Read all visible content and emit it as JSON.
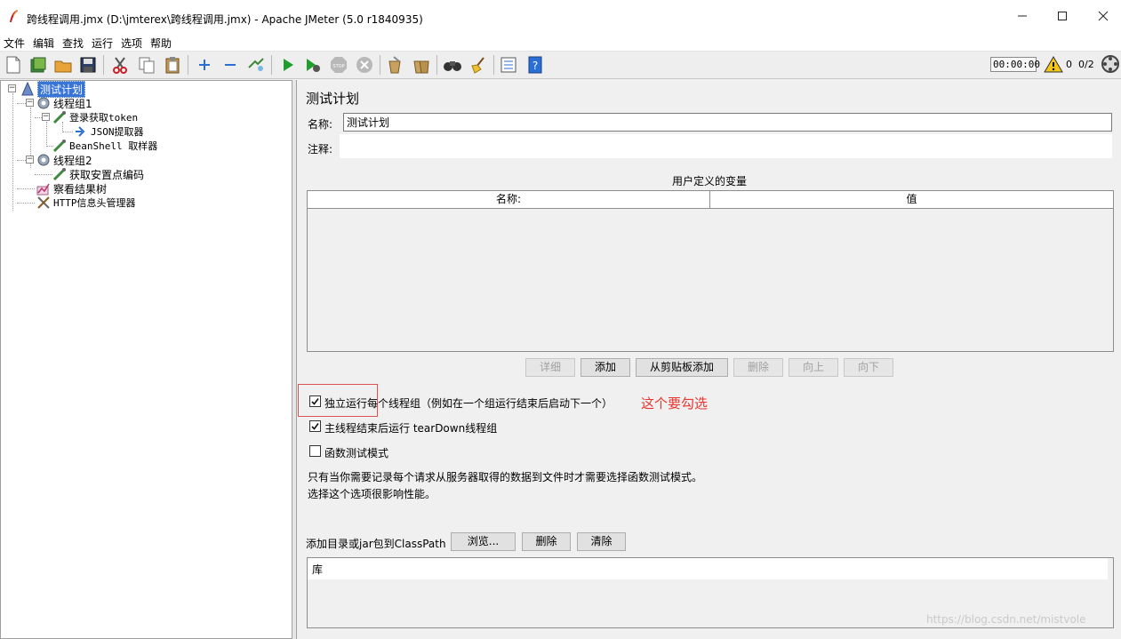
{
  "window": {
    "title": "跨线程调用.jmx (D:\\jmterex\\跨线程调用.jmx) - Apache JMeter (5.0 r1840935)"
  },
  "menu": [
    "文件",
    "编辑",
    "查找",
    "运行",
    "选项",
    "帮助"
  ],
  "toolbar": {
    "timer": "00:00:00",
    "warning_count": "0",
    "threads": "0/2"
  },
  "tree": {
    "test_plan": "测试计划",
    "thread_group_1": "线程组1",
    "login_sampler": "登录获取token",
    "json_extractor": "JSON提取器",
    "beanshell_sampler": "BeanShell 取样器",
    "thread_group_2": "线程组2",
    "get_ids_sampler": "获取安置点编码",
    "view_results_tree": "察看结果树",
    "http_header_manager": "HTTP信息头管理器"
  },
  "panel": {
    "title": "测试计划",
    "name_label": "名称:",
    "name_value": "测试计划",
    "comment_label": "注释:",
    "comment_value": "",
    "user_vars_title": "用户定义的变量",
    "col_name": "名称:",
    "col_value": "值",
    "buttons": {
      "detail": "详细",
      "add": "添加",
      "add_from_clipboard": "从剪贴板添加",
      "delete": "删除",
      "up": "向上",
      "down": "向下"
    },
    "cb_serialize": "独立运行每个线程组（例如在一个组运行结束后启动下一个）",
    "cb_teardown": "主线程结束后运行 tearDown线程组",
    "cb_functional": "函数测试模式",
    "cb_serialize_checked": true,
    "cb_teardown_checked": true,
    "cb_functional_checked": false,
    "annotation": "这个要勾选",
    "info_line1": "只有当你需要记录每个请求从服务器取得的数据到文件时才需要选择函数测试模式。",
    "info_line2": "选择这个选项很影响性能。",
    "classpath_label": "添加目录或jar包到ClassPath",
    "browse": "浏览...",
    "cp_delete": "删除",
    "cp_clear": "清除",
    "library_header": "库"
  },
  "watermark": "https://blog.csdn.net/mistvole",
  "colors": {
    "selection": "#3875d7",
    "annotation": "#e8352f",
    "play": "#1e9e2a"
  }
}
